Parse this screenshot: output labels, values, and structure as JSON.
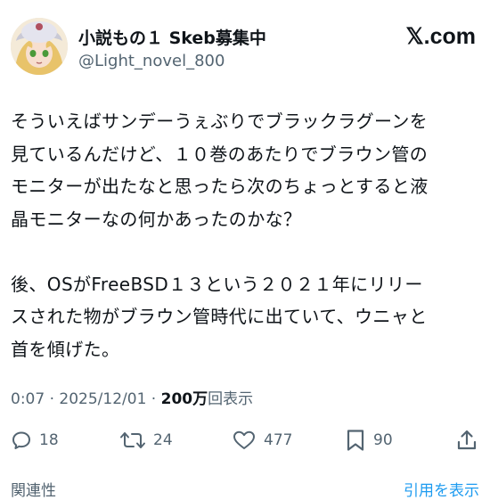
{
  "account": {
    "display_name": "小説もの１ Skeb募集中",
    "handle": "@Light_novel_800",
    "avatar_icon": "anime-avatar-icon"
  },
  "brand": {
    "label": "𝕏.com"
  },
  "post": {
    "text": "そういえばサンデーうぇぶりでブラックラグーンを\n見ているんだけど、１０巻のあたりでブラウン管の\nモニターが出たなと思ったら次のちょっとすると液\n晶モニターなの何かあったのかな？\n\n後、OSがFreeBSD１３という２０２１年にリリー\nスされた物がブラウン管時代に出ていて、ウニャと\n首を傾げた。"
  },
  "meta": {
    "time": "0:07",
    "separator1": " · ",
    "date": "2025/12/01",
    "separator2": " · ",
    "views_count": "200万",
    "views_label": "回表示"
  },
  "actions": {
    "reply_count": "18",
    "repost_count": "24",
    "like_count": "477",
    "bookmark_count": "90",
    "icons": [
      "reply-icon",
      "repost-icon",
      "like-icon",
      "bookmark-icon",
      "share-icon"
    ]
  },
  "bottom": {
    "left_label": "関連性",
    "right_label": "引用を表示"
  },
  "colors": {
    "text": "#0f1419",
    "secondary": "#536471",
    "link": "#1d9bf0"
  }
}
